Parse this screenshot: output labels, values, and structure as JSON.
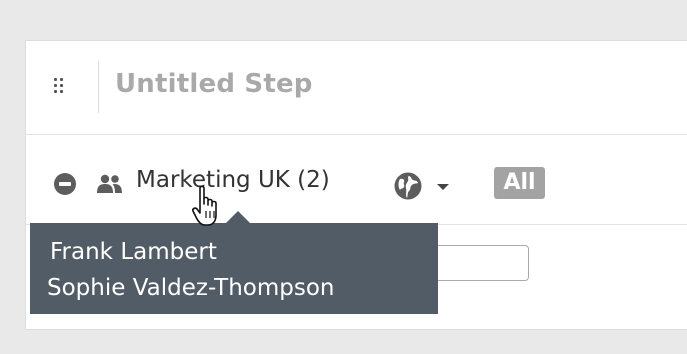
{
  "step": {
    "title": "Untitled Step"
  },
  "group": {
    "label": "Marketing UK (2)",
    "icons": {
      "remove": "minus-circle-icon",
      "users": "users-icon",
      "visibility": "globe-icon",
      "dropdown": "caret-down-icon",
      "drag": "drag-handle-icon",
      "cursor": "hand-pointer-cursor"
    }
  },
  "scope_badge": {
    "label": "All"
  },
  "tooltip": {
    "members": [
      "Frank Lambert",
      "Sophie Valdez-Thompson"
    ]
  },
  "colors": {
    "tooltip_bg": "#525c66",
    "badge_bg": "#a3a3a3",
    "title_text": "#a9a9a9"
  }
}
